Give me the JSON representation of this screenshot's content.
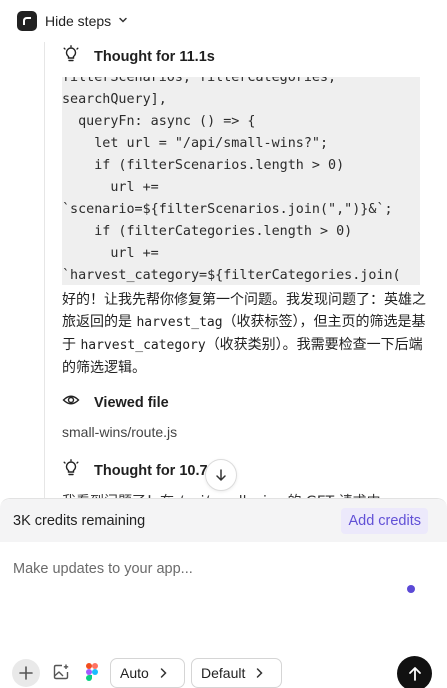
{
  "header": {
    "hide_steps_label": "Hide steps",
    "logo_icon": "app-logo-icon",
    "chevron_icon": "chevron-down-icon"
  },
  "steps": [
    {
      "icon": "lightbulb-icon",
      "title": "Thought for 11.1s"
    },
    {
      "icon": "eye-icon",
      "title": "Viewed file",
      "file": "small-wins/route.js"
    },
    {
      "icon": "lightbulb-icon",
      "title": "Thought for 10.7s"
    }
  ],
  "code_block": {
    "lines": [
      "filterScenarios, filterCategories,",
      "searchQuery],",
      "  queryFn: async () => {",
      "    let url = \"/api/small-wins?\";",
      "    if (filterScenarios.length > 0)",
      "      url +=",
      "`scenario=${filterScenarios.join(\",\")}&`;",
      "    if (filterCategories.length > 0)",
      "      url +=",
      "`harvest_category=${filterCategories.join("
    ]
  },
  "message": {
    "part1": "好的！让我先帮你修复第一个问题。我发现问题了：英雄之旅返回的是 ",
    "code1": "harvest_tag",
    "part2": "（收获标签），但主页的筛选是基于 ",
    "code2": "harvest_category",
    "part3": "（收获类别）。我需要检查一下后端的筛选逻辑。"
  },
  "partial_text": "我看到问题了！在 /api/small-wins 的 GET 请求中",
  "credits": {
    "remaining": "3K credits remaining",
    "add_label": "Add credits"
  },
  "composer": {
    "placeholder": "Make updates to your app..."
  },
  "toolbar": {
    "model_label": "Auto",
    "mode_label": "Default",
    "icons": [
      "plus-icon",
      "image-sparkle-icon",
      "figma-icon",
      "send-arrow-icon"
    ]
  },
  "colors": {
    "accent": "#5b49d6",
    "add_credits_bg": "#ece9fb",
    "code_bg": "#efefef",
    "send_bg": "#111111"
  }
}
